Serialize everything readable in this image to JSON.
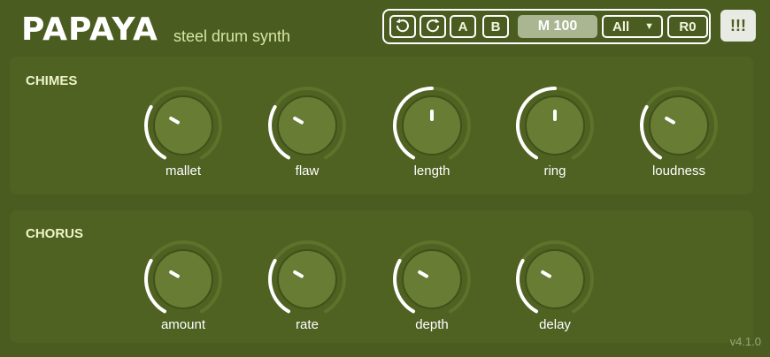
{
  "header": {
    "title": "PAPAYA",
    "subtitle": "steel drum synth"
  },
  "toolbar": {
    "undo_icon": "undo-icon",
    "redo_icon": "redo-icon",
    "preset_a_label": "A",
    "preset_b_label": "B",
    "midi_label": "M 100",
    "channel_value": "All",
    "reset_label": "R0",
    "menu_label": "!!!"
  },
  "sections": {
    "chimes": {
      "title": "CHIMES",
      "knobs": [
        {
          "label": "mallet",
          "value": 0.3
        },
        {
          "label": "flaw",
          "value": 0.3
        },
        {
          "label": "length",
          "value": 0.5
        },
        {
          "label": "ring",
          "value": 0.5
        },
        {
          "label": "loudness",
          "value": 0.3
        }
      ]
    },
    "chorus": {
      "title": "CHORUS",
      "knobs": [
        {
          "label": "amount",
          "value": 0.3
        },
        {
          "label": "rate",
          "value": 0.3
        },
        {
          "label": "depth",
          "value": 0.3
        },
        {
          "label": "delay",
          "value": 0.3
        }
      ]
    }
  },
  "footer": {
    "version": "v4.1.0"
  },
  "colors": {
    "background": "#4a5c1f",
    "panel": "#4f6222",
    "knob_face": "#687c34",
    "track": "#5d722a",
    "accent": "#ffffff",
    "subtitle": "#d8e6a6",
    "midi_button": "#a9b691"
  }
}
